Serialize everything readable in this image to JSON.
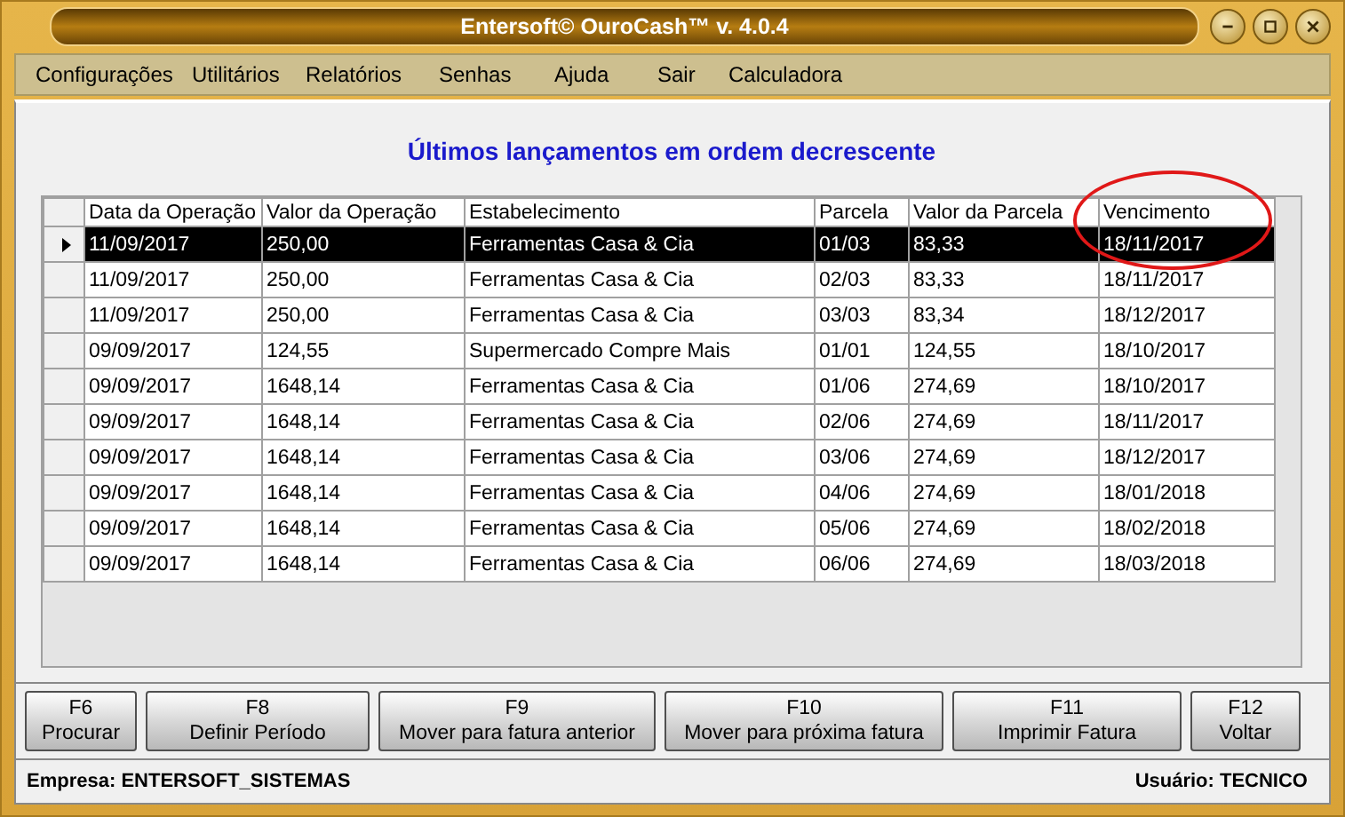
{
  "window": {
    "title": "Entersoft© OuroCash™ v. 4.0.4"
  },
  "menu": [
    "Configurações",
    "Utilitários",
    "Relatórios",
    "Senhas",
    "Ajuda",
    "Sair",
    "Calculadora"
  ],
  "heading": "Últimos lançamentos em ordem decrescente",
  "table": {
    "columns": [
      "Data da Operação",
      "Valor da Operação",
      "Estabelecimento",
      "Parcela",
      "Valor da Parcela",
      "Vencimento"
    ],
    "rows": [
      {
        "selected": true,
        "cells": [
          "11/09/2017",
          "250,00",
          "Ferramentas Casa & Cia",
          "01/03",
          "83,33",
          "18/11/2017"
        ]
      },
      {
        "selected": false,
        "cells": [
          "11/09/2017",
          "250,00",
          "Ferramentas Casa & Cia",
          "02/03",
          "83,33",
          "18/11/2017"
        ]
      },
      {
        "selected": false,
        "cells": [
          "11/09/2017",
          "250,00",
          "Ferramentas Casa & Cia",
          "03/03",
          "83,34",
          "18/12/2017"
        ]
      },
      {
        "selected": false,
        "cells": [
          "09/09/2017",
          "124,55",
          "Supermercado Compre Mais",
          "01/01",
          "124,55",
          "18/10/2017"
        ]
      },
      {
        "selected": false,
        "cells": [
          "09/09/2017",
          "1648,14",
          "Ferramentas Casa & Cia",
          "01/06",
          "274,69",
          "18/10/2017"
        ]
      },
      {
        "selected": false,
        "cells": [
          "09/09/2017",
          "1648,14",
          "Ferramentas Casa & Cia",
          "02/06",
          "274,69",
          "18/11/2017"
        ]
      },
      {
        "selected": false,
        "cells": [
          "09/09/2017",
          "1648,14",
          "Ferramentas Casa & Cia",
          "03/06",
          "274,69",
          "18/12/2017"
        ]
      },
      {
        "selected": false,
        "cells": [
          "09/09/2017",
          "1648,14",
          "Ferramentas Casa & Cia",
          "04/06",
          "274,69",
          "18/01/2018"
        ]
      },
      {
        "selected": false,
        "cells": [
          "09/09/2017",
          "1648,14",
          "Ferramentas Casa & Cia",
          "05/06",
          "274,69",
          "18/02/2018"
        ]
      },
      {
        "selected": false,
        "cells": [
          "09/09/2017",
          "1648,14",
          "Ferramentas Casa & Cia",
          "06/06",
          "274,69",
          "18/03/2018"
        ]
      }
    ]
  },
  "annotations": [
    {
      "kind": "ellipse",
      "color": "#e01818"
    }
  ],
  "buttons": [
    {
      "key": "F6",
      "label": "Procurar"
    },
    {
      "key": "F8",
      "label": "Definir Período"
    },
    {
      "key": "F9",
      "label": "Mover para fatura anterior"
    },
    {
      "key": "F10",
      "label": "Mover para próxima fatura"
    },
    {
      "key": "F11",
      "label": "Imprimir Fatura"
    },
    {
      "key": "F12",
      "label": "Voltar"
    }
  ],
  "status_bar": {
    "left": "Empresa: ENTERSOFT_SISTEMAS",
    "right": "Usuário: TECNICO"
  }
}
